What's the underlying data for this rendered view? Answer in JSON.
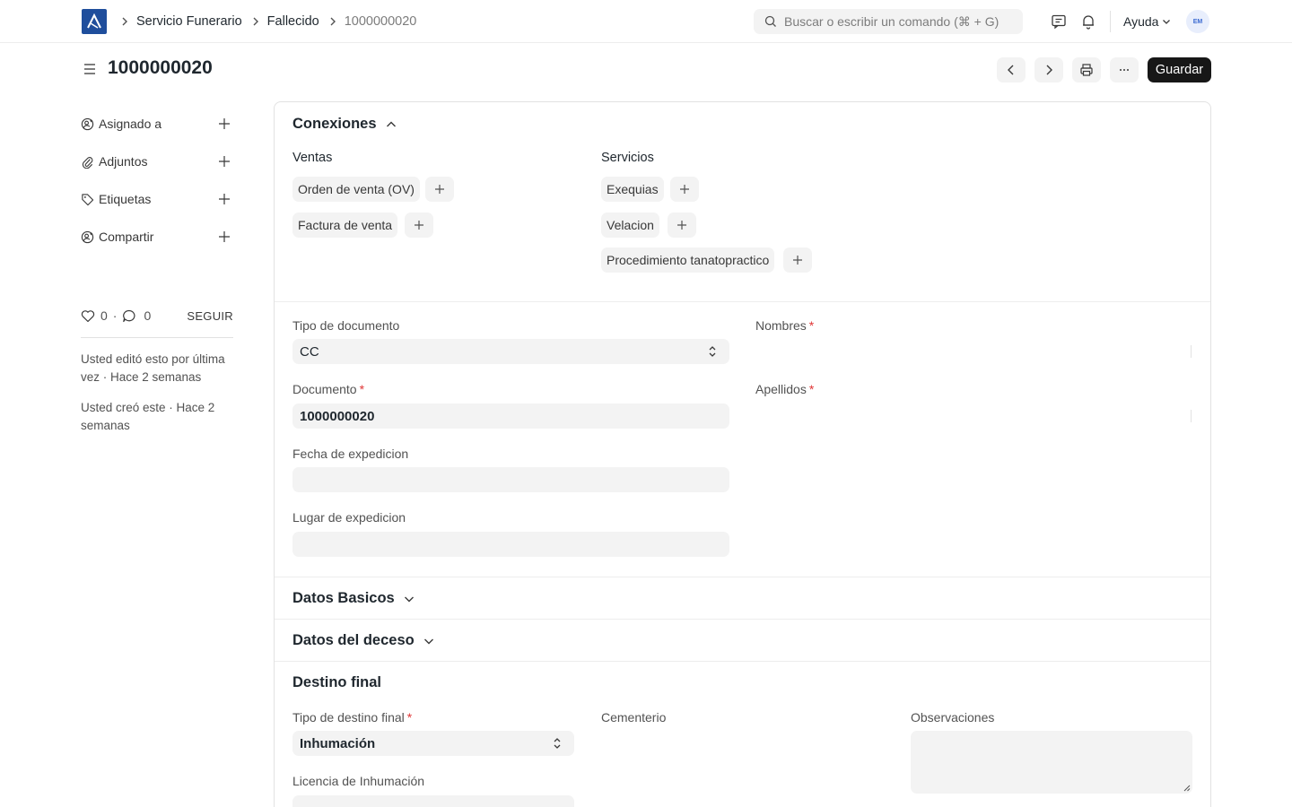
{
  "navbar": {
    "breadcrumbs": [
      "Servicio Funerario",
      "Fallecido",
      "1000000020"
    ],
    "search_placeholder": "Buscar o escribir un comando (⌘ + G)",
    "help_label": "Ayuda",
    "avatar_initials": "EM"
  },
  "page": {
    "title": "1000000020",
    "save_label": "Guardar"
  },
  "sidebar": {
    "items": [
      {
        "label": "Asignado a",
        "icon": "assign-icon"
      },
      {
        "label": "Adjuntos",
        "icon": "paperclip-icon"
      },
      {
        "label": "Etiquetas",
        "icon": "tag-icon"
      },
      {
        "label": "Compartir",
        "icon": "share-icon"
      }
    ],
    "likes": "0",
    "comments": "0",
    "separator": "·",
    "follow_label": "SEGUIR",
    "edited_note": "Usted editó esto por última vez · Hace 2 semanas",
    "created_note": "Usted creó este · Hace 2 semanas"
  },
  "connections": {
    "title": "Conexiones",
    "groups": [
      {
        "title": "Ventas",
        "items": [
          "Orden de venta (OV)",
          "Factura de venta"
        ]
      },
      {
        "title": "Servicios",
        "items": [
          "Exequias",
          "Velacion",
          "Procedimiento tanatopractico"
        ]
      }
    ]
  },
  "form": {
    "tipo_documento": {
      "label": "Tipo de documento",
      "value": "CC"
    },
    "documento": {
      "label": "Documento",
      "value": "1000000020"
    },
    "fecha_expedicion": {
      "label": "Fecha de expedicion",
      "value": ""
    },
    "lugar_expedicion": {
      "label": "Lugar de expedicion",
      "value": ""
    },
    "nombres": {
      "label": "Nombres",
      "value": ""
    },
    "apellidos": {
      "label": "Apellidos",
      "value": ""
    },
    "required_mark": "*"
  },
  "sections": {
    "datos_basicos": "Datos Basicos",
    "datos_deceso": "Datos del deceso",
    "destino_final": "Destino final"
  },
  "destino": {
    "tipo": {
      "label": "Tipo de destino final",
      "value": "Inhumación"
    },
    "licencia": {
      "label": "Licencia de Inhumación",
      "value": ""
    },
    "cementerio": {
      "label": "Cementerio",
      "value": ""
    },
    "observaciones": {
      "label": "Observaciones",
      "value": ""
    }
  },
  "colors": {
    "brand": "#1f4e9c",
    "primary_button": "#171717",
    "required": "#e03636",
    "field_bg": "#f3f3f3"
  }
}
